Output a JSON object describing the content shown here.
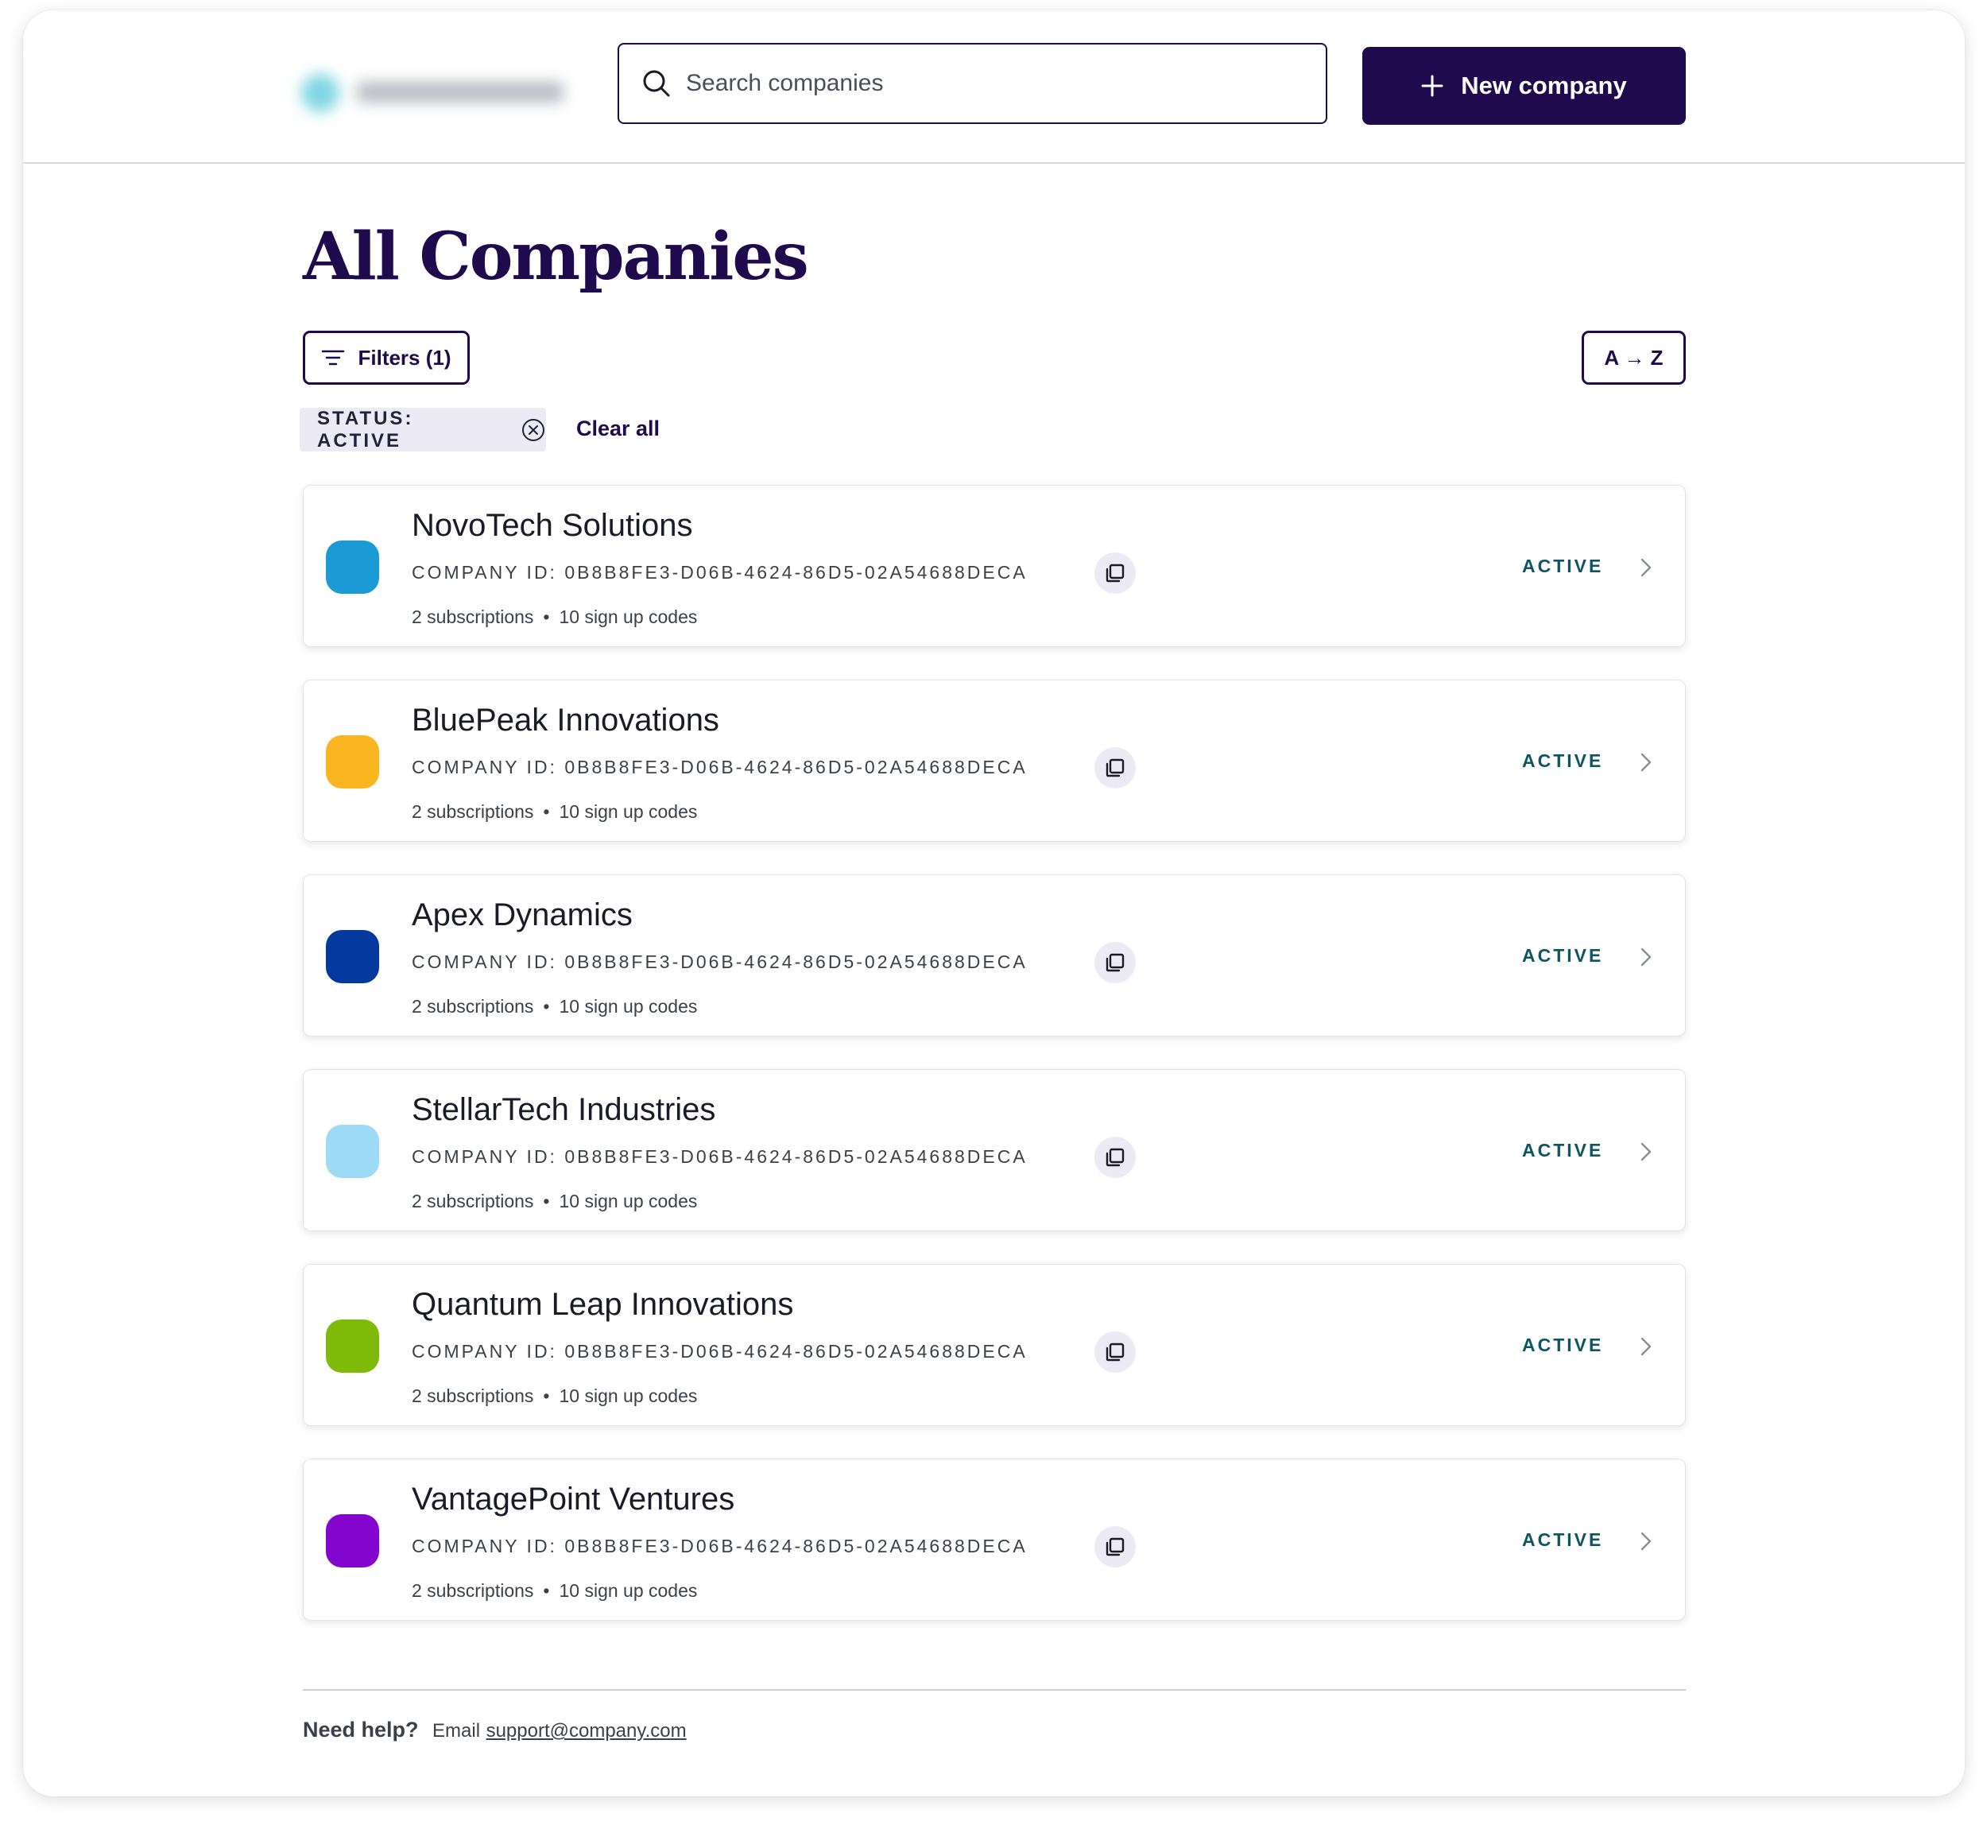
{
  "header": {
    "search_placeholder": "Search companies",
    "new_company_label": "New company"
  },
  "page": {
    "title": "All Companies"
  },
  "toolbar": {
    "filters_label": "Filters (1)",
    "sort_label": "A → Z"
  },
  "active_filter": {
    "label": "STATUS: ACTIVE",
    "clear_all_label": "Clear all"
  },
  "companies": [
    {
      "name": "NovoTech Solutions",
      "company_id": "COMPANY ID: 0B8B8FE3-D06B-4624-86D5-02A54688DECA",
      "subscriptions": "2 subscriptions",
      "signup_codes": "10 sign up codes",
      "status": "ACTIVE",
      "color": "#1B9AD6"
    },
    {
      "name": "BluePeak Innovations",
      "company_id": "COMPANY ID: 0B8B8FE3-D06B-4624-86D5-02A54688DECA",
      "subscriptions": "2 subscriptions",
      "signup_codes": "10 sign up codes",
      "status": "ACTIVE",
      "color": "#FBB520"
    },
    {
      "name": "Apex Dynamics",
      "company_id": "COMPANY ID: 0B8B8FE3-D06B-4624-86D5-02A54688DECA",
      "subscriptions": "2 subscriptions",
      "signup_codes": "10 sign up codes",
      "status": "ACTIVE",
      "color": "#043A9E"
    },
    {
      "name": "StellarTech Industries",
      "company_id": "COMPANY ID: 0B8B8FE3-D06B-4624-86D5-02A54688DECA",
      "subscriptions": "2 subscriptions",
      "signup_codes": "10 sign up codes",
      "status": "ACTIVE",
      "color": "#9DDAF6"
    },
    {
      "name": "Quantum Leap Innovations",
      "company_id": "COMPANY ID: 0B8B8FE3-D06B-4624-86D5-02A54688DECA",
      "subscriptions": "2 subscriptions",
      "signup_codes": "10 sign up codes",
      "status": "ACTIVE",
      "color": "#7FBA0A"
    },
    {
      "name": "VantagePoint Ventures",
      "company_id": "COMPANY ID: 0B8B8FE3-D06B-4624-86D5-02A54688DECA",
      "subscriptions": "2 subscriptions",
      "signup_codes": "10 sign up codes",
      "status": "ACTIVE",
      "color": "#8405CE"
    }
  ],
  "footer": {
    "help_label": "Need help?",
    "email_label": "Email",
    "email_address": "support@company.com"
  },
  "colors": {
    "brand_navy": "#1E0A4C",
    "status_teal": "#0E5560",
    "chip_bg": "#ECEBF5"
  },
  "icons": {
    "search": "search-icon",
    "plus": "plus-icon",
    "filter": "filter-icon",
    "chip_close": "close-circle-icon",
    "copy": "copy-icon",
    "chevron": "chevron-right-icon"
  }
}
